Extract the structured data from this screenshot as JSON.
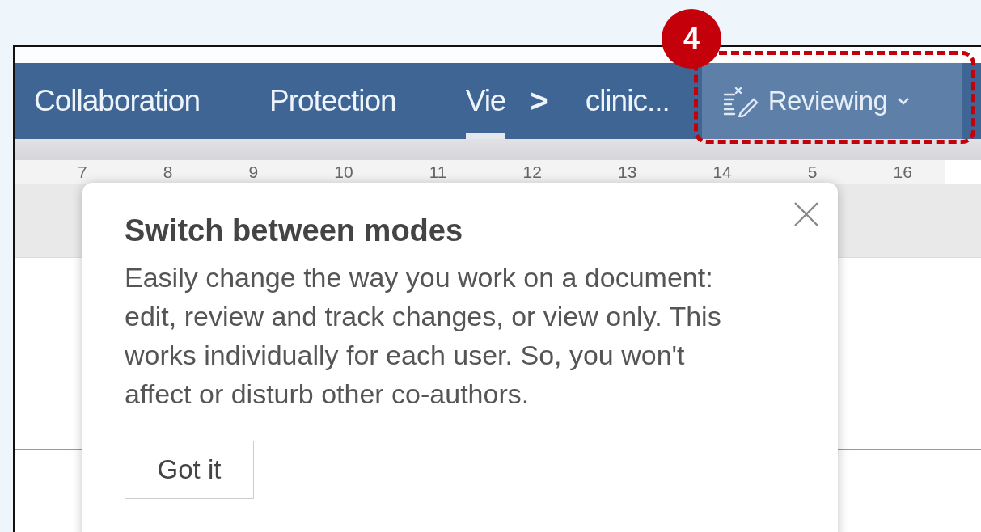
{
  "toolbar": {
    "tabs": [
      {
        "label": "Collaboration",
        "selected": false
      },
      {
        "label": "Protection",
        "selected": false
      },
      {
        "label": "Vie",
        "selected": true
      }
    ],
    "more_chevron": ">",
    "document_name": "clinic...",
    "mode_button": {
      "label": "Reviewing"
    }
  },
  "annotation": {
    "badge": "4"
  },
  "ruler": {
    "numbers": [
      "7",
      "8",
      "9",
      "10",
      "11",
      "12",
      "13",
      "14",
      "5",
      "16"
    ]
  },
  "popup": {
    "title": "Switch between modes",
    "body": "Easily change the way you work on a document: edit, review and track changes, or view only. This works individually for each user. So, you won't affect or disturb other co-authors.",
    "button": "Got it"
  }
}
